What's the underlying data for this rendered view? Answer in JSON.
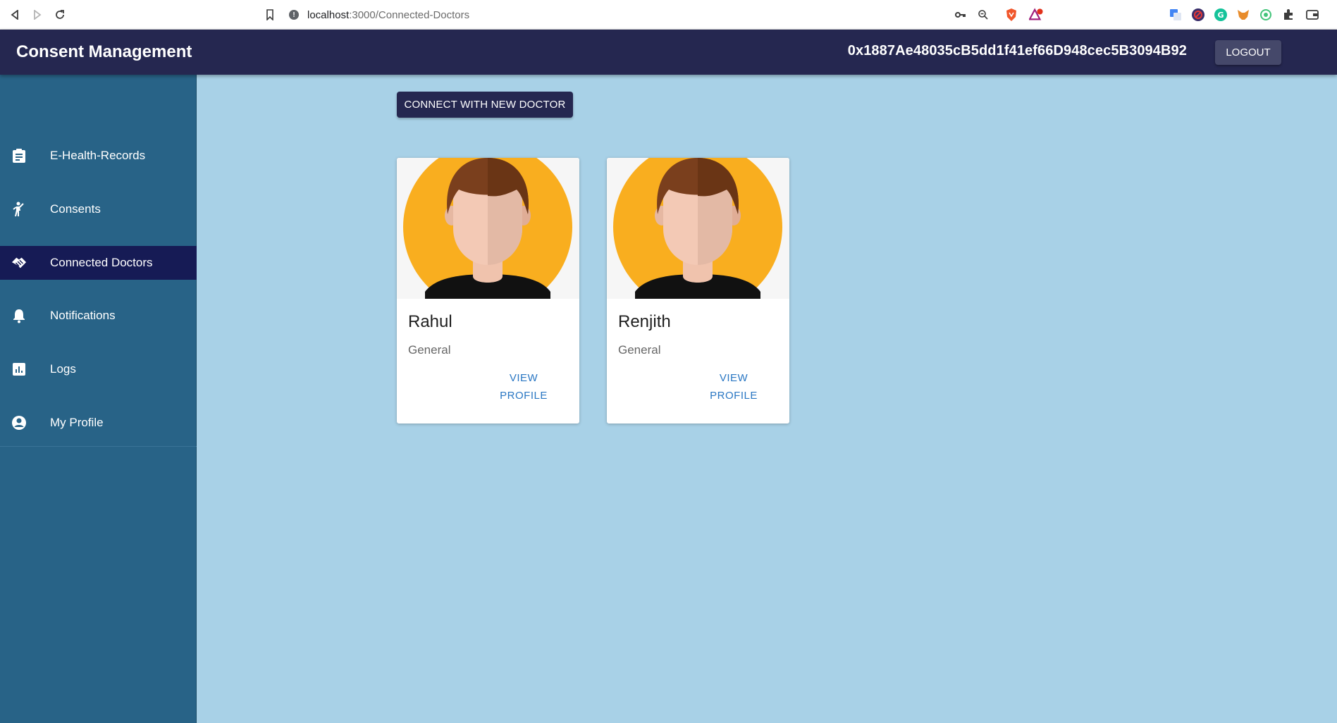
{
  "browser": {
    "url_host": "localhost",
    "url_path": ":3000/Connected-Doctors"
  },
  "header": {
    "title": "Consent Management",
    "wallet_address": "0x1887Ae48035cB5dd1f41ef66D948cec5B3094B92",
    "logout_label": "LOGOUT"
  },
  "sidebar": {
    "items": [
      {
        "label": "E-Health-Records",
        "icon": "clipboard-icon"
      },
      {
        "label": "Consents",
        "icon": "person-waving-icon"
      },
      {
        "label": "Connected Doctors",
        "icon": "handshake-icon",
        "active": true
      },
      {
        "label": "Notifications",
        "icon": "bell-icon"
      },
      {
        "label": "Logs",
        "icon": "chart-icon"
      },
      {
        "label": "My Profile",
        "icon": "account-circle-icon"
      }
    ]
  },
  "main": {
    "connect_button_label": "CONNECT WITH NEW DOCTOR",
    "doctors": [
      {
        "name": "Rahul",
        "specialty": "General",
        "action_line1": "VIEW",
        "action_line2": "PROFILE"
      },
      {
        "name": "Renjith",
        "specialty": "General",
        "action_line1": "VIEW",
        "action_line2": "PROFILE"
      }
    ]
  },
  "colors": {
    "header_bg": "#252750",
    "sidebar_bg": "#286387",
    "sidebar_active": "#161b55",
    "content_bg": "#a8d1e7",
    "link_blue": "#2a77c3",
    "avatar_bg": "#f9ae1f"
  }
}
